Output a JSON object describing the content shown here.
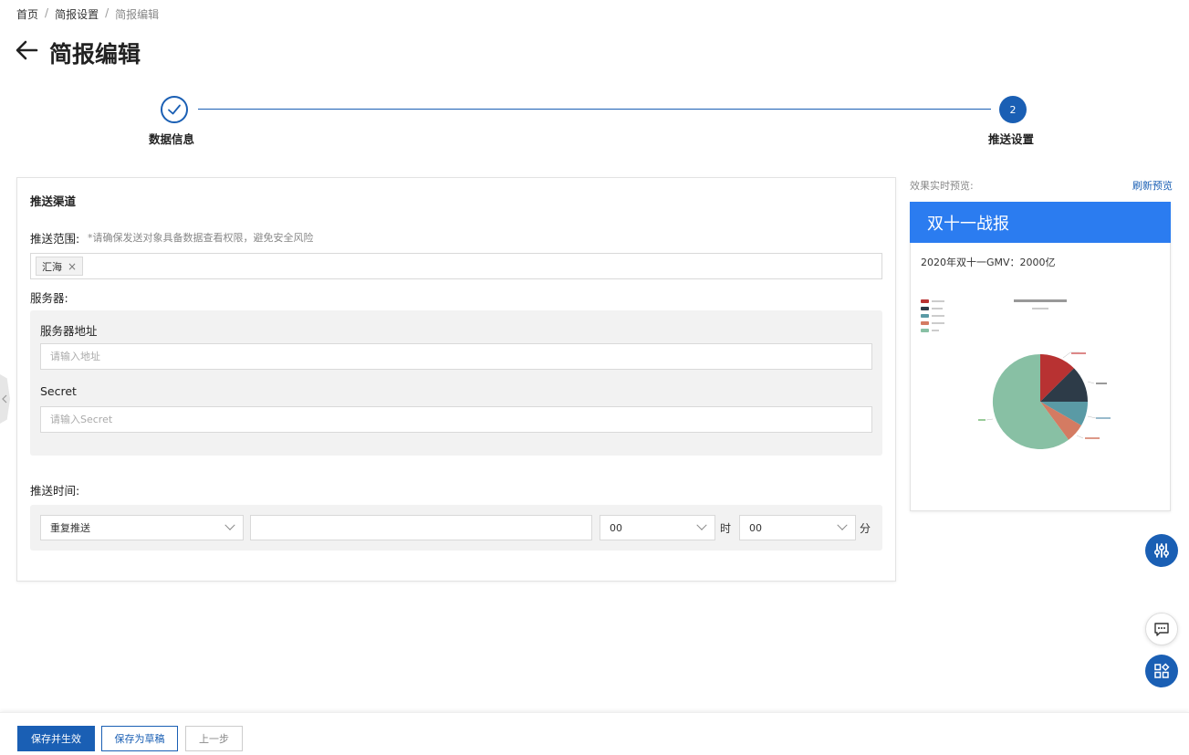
{
  "breadcrumb": {
    "items": [
      "首页",
      "简报设置",
      "简报编辑"
    ]
  },
  "page": {
    "title": "简报编辑"
  },
  "steps": [
    {
      "label": "数据信息",
      "status": "done"
    },
    {
      "label": "推送设置",
      "number": "2",
      "status": "active"
    }
  ],
  "form": {
    "section_title": "推送渠道",
    "scope": {
      "label": "推送范围:",
      "hint": "*请确保发送对象具备数据查看权限，避免安全风险",
      "tags": [
        "汇海"
      ]
    },
    "server": {
      "label": "服务器:",
      "address_label": "服务器地址",
      "address_placeholder": "请输入地址",
      "secret_label": "Secret",
      "secret_placeholder": "请输入Secret"
    },
    "time": {
      "label": "推送时间:",
      "repeat_value": "重复推送",
      "hour_value": "00",
      "hour_unit": "时",
      "minute_value": "00",
      "minute_unit": "分"
    }
  },
  "preview": {
    "label": "效果实时预览:",
    "refresh": "刷新预览",
    "header": "双十一战报",
    "gmv_text": "2020年双十一GMV：2000亿"
  },
  "footer": {
    "save_apply": "保存并生效",
    "save_draft": "保存为草稿",
    "prev": "上一步"
  },
  "colors": {
    "primary": "#1a5fb4",
    "preview_header": "#2b7cf0"
  }
}
